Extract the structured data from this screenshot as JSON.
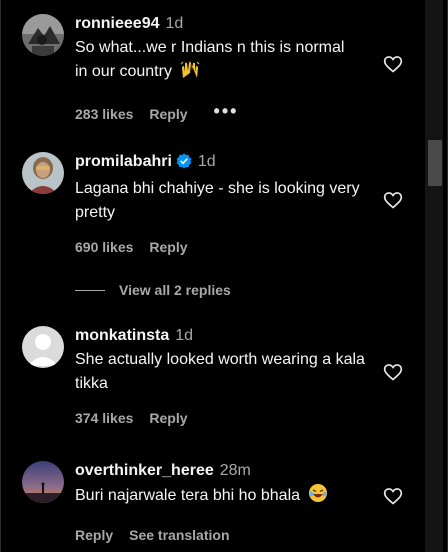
{
  "comments": [
    {
      "username": "ronnieee94",
      "time": "1d",
      "verified": false,
      "text": "So what...we r Indians n this is normal in our country",
      "emoji": "raised-hands-emoji",
      "likes": "283 likes",
      "reply_label": "Reply",
      "more_label": "•••"
    },
    {
      "username": "promilabahri",
      "time": "1d",
      "verified": true,
      "text": "Lagana bhi chahiye - she is looking very pretty",
      "likes": "690 likes",
      "reply_label": "Reply",
      "view_replies": "View all 2 replies"
    },
    {
      "username": "monkatinsta",
      "time": "1d",
      "verified": false,
      "text": "She actually looked worth wearing a kala tikka",
      "likes": "374 likes",
      "reply_label": "Reply"
    },
    {
      "username": "overthinker_heree",
      "time": "28m",
      "verified": false,
      "text": "Buri najarwale tera bhi ho bhala",
      "emoji": "laughing-emoji",
      "reply_label": "Reply",
      "translation_label": "See translation"
    }
  ],
  "colors": {
    "background": "#000000",
    "primary_text": "#f5f5f5",
    "secondary_text": "#a8a8a8",
    "verified_badge": "#0095f6"
  }
}
